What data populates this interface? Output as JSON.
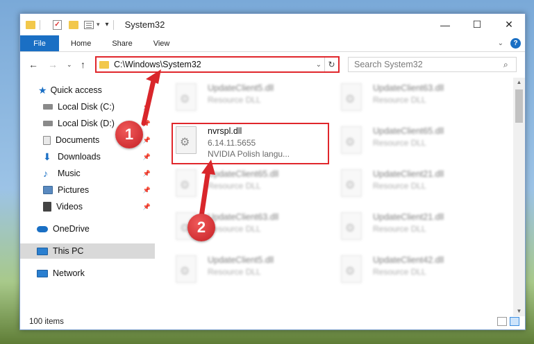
{
  "window": {
    "title": "System32",
    "controls": {
      "minimize": "—",
      "maximize": "☐",
      "close": "✕"
    }
  },
  "ribbon": {
    "file_tab": "File",
    "tabs": [
      "Home",
      "Share",
      "View"
    ],
    "help": "?"
  },
  "nav": {
    "address": "C:\\Windows\\System32",
    "search_placeholder": "Search System32"
  },
  "sidebar": {
    "items": [
      {
        "label": "Quick access",
        "icon": "star-icon",
        "color": "#1a6fc4",
        "pinned": false
      },
      {
        "label": "Local Disk (C:)",
        "icon": "drive-icon",
        "color": "#6a6a6a",
        "pinned": true
      },
      {
        "label": "Local Disk (D:)",
        "icon": "drive-icon",
        "color": "#6a6a6a",
        "pinned": true
      },
      {
        "label": "Documents",
        "icon": "documents-icon",
        "color": "#8a8a8a",
        "pinned": true
      },
      {
        "label": "Downloads",
        "icon": "downloads-icon",
        "color": "#1a6fc4",
        "pinned": true
      },
      {
        "label": "Music",
        "icon": "music-icon",
        "color": "#1a6fc4",
        "pinned": true
      },
      {
        "label": "Pictures",
        "icon": "pictures-icon",
        "color": "#5a8ac0",
        "pinned": true
      },
      {
        "label": "Videos",
        "icon": "videos-icon",
        "color": "#444444",
        "pinned": true
      },
      {
        "label": "OneDrive",
        "icon": "onedrive-icon",
        "color": "#1a6fc4",
        "pinned": false
      },
      {
        "label": "This PC",
        "icon": "pc-icon",
        "color": "#2a7fd0",
        "pinned": false,
        "selected": true
      },
      {
        "label": "Network",
        "icon": "network-icon",
        "color": "#2a7fd0",
        "pinned": false
      }
    ]
  },
  "files": {
    "left_column": [
      {
        "name": "UpdateClient5.dll",
        "type": "Resource DLL"
      },
      {
        "name": "nvrspl.dll",
        "version": "6.14.11.5655",
        "desc": "NVIDIA Polish langu..."
      },
      {
        "name": "UpdateClient65.dll",
        "type": "Resource DLL"
      },
      {
        "name": "UpdateClient63.dll",
        "type": "Resource DLL"
      },
      {
        "name": "UpdateClient5.dll",
        "type": "Resource DLL"
      }
    ],
    "right_column": [
      {
        "name": "UpdateClient63.dll",
        "type": "Resource DLL"
      },
      {
        "name": "UpdateClient65.dll",
        "type": "Resource DLL"
      },
      {
        "name": "UpdateClient21.dll",
        "type": "Resource DLL"
      },
      {
        "name": "UpdateClient21.dll",
        "type": "Resource DLL"
      },
      {
        "name": "UpdateClient42.dll",
        "type": "Resource DLL"
      }
    ]
  },
  "status": {
    "items_count": "100 items"
  },
  "annotations": {
    "marker_1": "1",
    "marker_2": "2",
    "color": "#e0262b"
  }
}
